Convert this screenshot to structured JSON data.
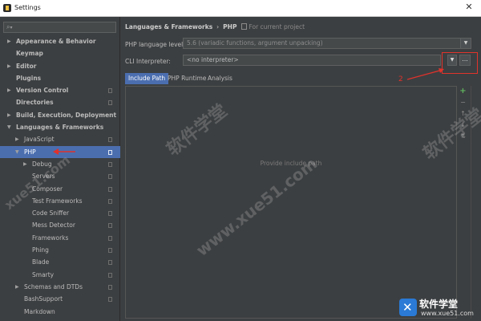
{
  "window": {
    "title": "Settings"
  },
  "search": {
    "icon": "search-icon"
  },
  "tree": [
    {
      "label": "Appearance & Behavior",
      "arrow": "▶",
      "bold": true,
      "indent": 0,
      "copy": false
    },
    {
      "label": "Keymap",
      "arrow": "",
      "bold": true,
      "indent": 0,
      "copy": false
    },
    {
      "label": "Editor",
      "arrow": "▶",
      "bold": true,
      "indent": 0,
      "copy": false
    },
    {
      "label": "Plugins",
      "arrow": "",
      "bold": true,
      "indent": 0,
      "copy": false
    },
    {
      "label": "Version Control",
      "arrow": "▶",
      "bold": true,
      "indent": 0,
      "copy": true
    },
    {
      "label": "Directories",
      "arrow": "",
      "bold": true,
      "indent": 0,
      "copy": true
    },
    {
      "label": "Build, Execution, Deployment",
      "arrow": "▶",
      "bold": true,
      "indent": 0,
      "copy": false
    },
    {
      "label": "Languages & Frameworks",
      "arrow": "▼",
      "bold": true,
      "indent": 0,
      "copy": false
    },
    {
      "label": "JavaScript",
      "arrow": "▶",
      "bold": false,
      "indent": 1,
      "copy": true
    },
    {
      "label": "PHP",
      "arrow": "▼",
      "bold": false,
      "indent": 1,
      "copy": true,
      "selected": true
    },
    {
      "label": "Debug",
      "arrow": "▶",
      "bold": false,
      "indent": 2,
      "copy": true
    },
    {
      "label": "Servers",
      "arrow": "",
      "bold": false,
      "indent": 2,
      "copy": true
    },
    {
      "label": "Composer",
      "arrow": "",
      "bold": false,
      "indent": 2,
      "copy": true
    },
    {
      "label": "Test Frameworks",
      "arrow": "",
      "bold": false,
      "indent": 2,
      "copy": true
    },
    {
      "label": "Code Sniffer",
      "arrow": "",
      "bold": false,
      "indent": 2,
      "copy": true
    },
    {
      "label": "Mess Detector",
      "arrow": "",
      "bold": false,
      "indent": 2,
      "copy": true
    },
    {
      "label": "Frameworks",
      "arrow": "",
      "bold": false,
      "indent": 2,
      "copy": true
    },
    {
      "label": "Phing",
      "arrow": "",
      "bold": false,
      "indent": 2,
      "copy": true
    },
    {
      "label": "Blade",
      "arrow": "",
      "bold": false,
      "indent": 2,
      "copy": true
    },
    {
      "label": "Smarty",
      "arrow": "",
      "bold": false,
      "indent": 2,
      "copy": true
    },
    {
      "label": "Schemas and DTDs",
      "arrow": "▶",
      "bold": false,
      "indent": 1,
      "copy": true
    },
    {
      "label": "BashSupport",
      "arrow": "",
      "bold": false,
      "indent": 1,
      "copy": true
    },
    {
      "label": "Markdown",
      "arrow": "",
      "bold": false,
      "indent": 1,
      "copy": false
    }
  ],
  "breadcrumb": {
    "section": "Languages & Frameworks",
    "page": "PHP",
    "note": "For current project"
  },
  "php_level": {
    "label": "PHP language level:",
    "value": "5.6 (variadic functions, argument unpacking)"
  },
  "cli": {
    "label": "CLI Interpreter:",
    "value": "<no interpreter>",
    "more_label": "..."
  },
  "tabs": [
    {
      "label": "Include Path",
      "active": true
    },
    {
      "label": "PHP Runtime",
      "active": false
    },
    {
      "label": "Analysis",
      "active": false
    }
  ],
  "include_path": {
    "empty_text": "Provide include path"
  },
  "tools": [
    {
      "icon": "add-icon",
      "glyph": "+"
    },
    {
      "icon": "remove-icon",
      "glyph": "−"
    },
    {
      "icon": "move-up-icon",
      "glyph": "↑"
    },
    {
      "icon": "move-down-icon",
      "glyph": "↓"
    },
    {
      "icon": "sort-icon",
      "glyph": "↓↑"
    }
  ],
  "annotations": {
    "step_number": "2",
    "colors": {
      "annotation": "#e0322c",
      "selection": "#4b6eaf"
    }
  },
  "watermark": {
    "text1": "软件学堂",
    "text2": "www.xue51.com",
    "text3": "xue51.com"
  },
  "brand": {
    "name": "软件学堂",
    "url": "www.xue51.com"
  }
}
